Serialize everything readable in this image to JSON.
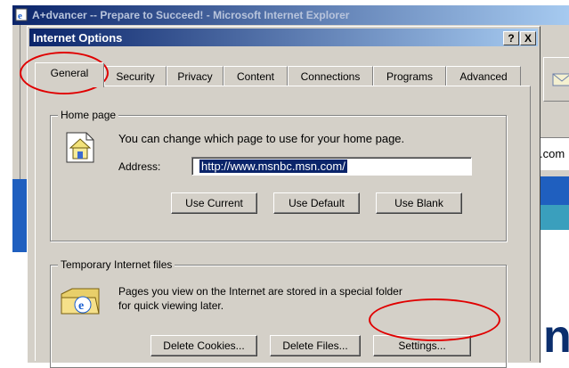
{
  "browser": {
    "window_title": "A+dvancer -- Prepare to Succeed! - Microsoft Internet Explorer",
    "address_fragment": ".com",
    "content_fragment": "ne"
  },
  "dialog": {
    "title": "Internet Options",
    "help_label": "?",
    "close_label": "X",
    "tabs": [
      {
        "label": "General",
        "active": true
      },
      {
        "label": "Security",
        "active": false
      },
      {
        "label": "Privacy",
        "active": false
      },
      {
        "label": "Content",
        "active": false
      },
      {
        "label": "Connections",
        "active": false
      },
      {
        "label": "Programs",
        "active": false
      },
      {
        "label": "Advanced",
        "active": false
      }
    ]
  },
  "home_page": {
    "group_label": "Home page",
    "description": "You can change which page to use for your home page.",
    "address_label": "Address:",
    "address_value": "http://www.msnbc.msn.com/",
    "buttons": {
      "use_current": "Use Current",
      "use_default": "Use Default",
      "use_blank": "Use Blank"
    }
  },
  "temp_files": {
    "group_label": "Temporary Internet files",
    "description_line1": "Pages you view on the Internet are stored in a special folder",
    "description_line2": "for quick viewing later.",
    "buttons": {
      "delete_cookies": "Delete Cookies...",
      "delete_files": "Delete Files...",
      "settings": "Settings..."
    }
  },
  "colors": {
    "annotation": "#e00000",
    "titlebar_start": "#0a246a",
    "titlebar_end": "#a6caf0",
    "dialog_face": "#d4d0c8"
  },
  "icons": [
    "ie-page-icon",
    "home-page-icon",
    "ie-folder-icon",
    "envelope-icon"
  ]
}
